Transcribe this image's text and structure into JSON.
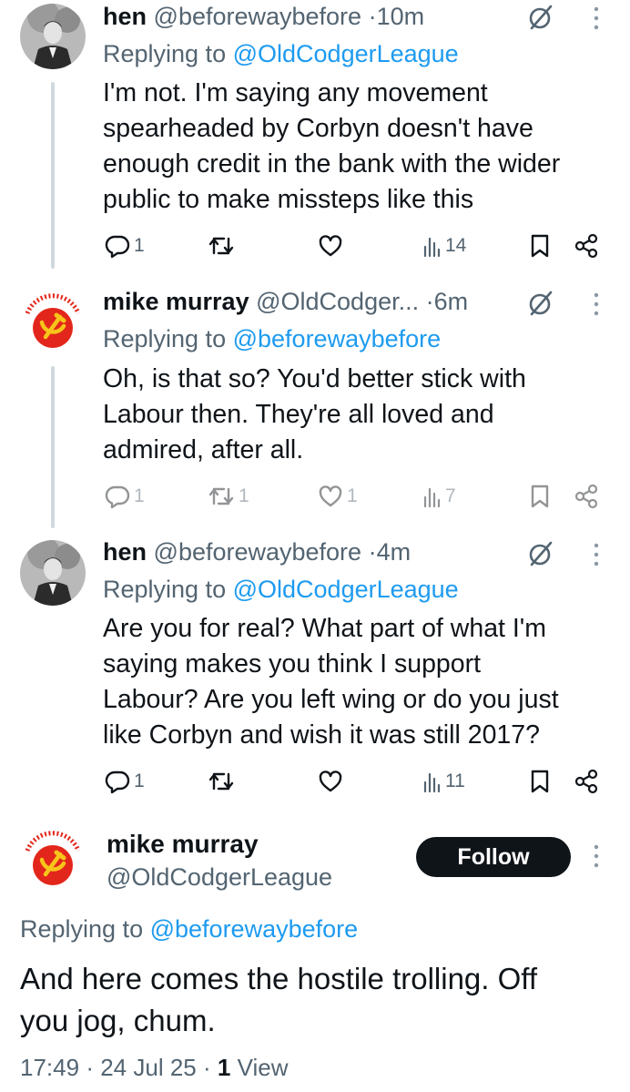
{
  "tweets": [
    {
      "name": "hen",
      "handle": "@beforewaybefore",
      "separator": "·",
      "time": "10m",
      "replying_prefix": "Replying to",
      "replying_to": "@OldCodgerLeague",
      "lines": [
        "I'm not. I'm saying any movement",
        "spearheaded by Corbyn doesn't have",
        "enough credit in the bank with the wider",
        "public to make missteps like this"
      ],
      "replies": "1",
      "retweets": "",
      "likes": "",
      "views": "14",
      "avatar": "person-photo"
    },
    {
      "name": "mike murray",
      "handle": "@OldCodger...",
      "separator": "·",
      "time": "6m",
      "replying_prefix": "Replying to",
      "replying_to": "@beforewaybefore",
      "lines": [
        "Oh, is that so? You'd better stick with",
        "Labour then. They're all loved and",
        "admired, after all."
      ],
      "replies": "1",
      "retweets": "1",
      "likes": "1",
      "views": "7",
      "avatar": "communist-party-logo",
      "logo_text": "COMMUNIST PARTY"
    },
    {
      "name": "hen",
      "handle": "@beforewaybefore",
      "separator": "·",
      "time": "4m",
      "replying_prefix": "Replying to",
      "replying_to": "@OldCodgerLeague",
      "lines": [
        "Are you for real? What part of what I'm",
        "saying makes you think I support",
        "Labour? Are you left wing or do you just",
        "like Corbyn and wish it was still 2017?"
      ],
      "replies": "1",
      "retweets": "",
      "likes": "",
      "views": "11",
      "avatar": "person-photo"
    }
  ],
  "main_tweet": {
    "name": "mike murray",
    "handle": "@OldCodgerLeague",
    "follow_label": "Follow",
    "replying_prefix": "Replying to",
    "replying_to": "@beforewaybefore",
    "lines": [
      "And here comes the hostile trolling. Off",
      "you jog, chum."
    ],
    "time": "17:49",
    "sep1": "·",
    "date": "24 Jul 25",
    "sep2": "·",
    "views_count": "1",
    "views_label": "View",
    "avatar": "communist-party-logo"
  },
  "colors": {
    "text": "#0f1419",
    "secondary": "#536471",
    "link": "#1d9bf0",
    "thread_line": "#cfd9de",
    "logo_red": "#e3261b",
    "logo_yellow": "#f7c51a",
    "follow_bg": "#0f1419"
  },
  "icons": [
    "reply-icon",
    "retweet-icon",
    "like-icon",
    "views-icon",
    "bookmark-icon",
    "share-icon",
    "grok-icon",
    "more-icon"
  ]
}
